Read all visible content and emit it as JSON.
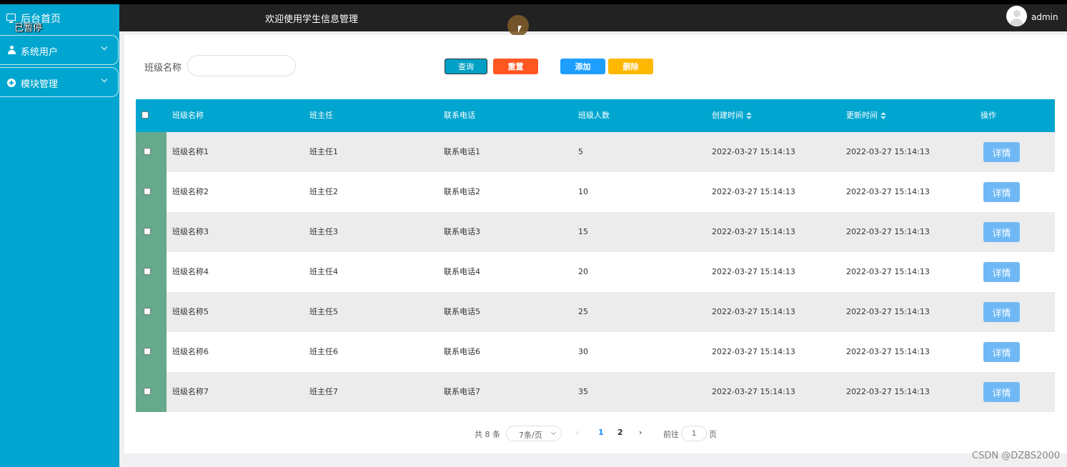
{
  "sidebar": {
    "home_label": "后台首页",
    "paused_label": "已暂停",
    "items": [
      {
        "label": "系统用户",
        "icon": "user-icon"
      },
      {
        "label": "模块管理",
        "icon": "plus-circle-icon"
      }
    ]
  },
  "header": {
    "title": "欢迎使用学生信息管理",
    "username": "admin"
  },
  "search": {
    "label": "班级名称",
    "value": "",
    "placeholder": ""
  },
  "toolbar": {
    "query_label": "查询",
    "reset_label": "重置",
    "add_label": "添加",
    "delete_label": "删除"
  },
  "table": {
    "columns": [
      "班级名称",
      "班主任",
      "联系电话",
      "班级人数",
      "创建时间",
      "更新时间",
      "操作"
    ],
    "detail_label": "详情",
    "rows": [
      [
        "班级名称1",
        "班主任1",
        "联系电话1",
        "5",
        "2022-03-27 15:14:13",
        "2022-03-27 15:14:13"
      ],
      [
        "班级名称2",
        "班主任2",
        "联系电话2",
        "10",
        "2022-03-27 15:14:13",
        "2022-03-27 15:14:13"
      ],
      [
        "班级名称3",
        "班主任3",
        "联系电话3",
        "15",
        "2022-03-27 15:14:13",
        "2022-03-27 15:14:13"
      ],
      [
        "班级名称4",
        "班主任4",
        "联系电话4",
        "20",
        "2022-03-27 15:14:13",
        "2022-03-27 15:14:13"
      ],
      [
        "班级名称5",
        "班主任5",
        "联系电话5",
        "25",
        "2022-03-27 15:14:13",
        "2022-03-27 15:14:13"
      ],
      [
        "班级名称6",
        "班主任6",
        "联系电话6",
        "30",
        "2022-03-27 15:14:13",
        "2022-03-27 15:14:13"
      ],
      [
        "班级名称7",
        "班主任7",
        "联系电话7",
        "35",
        "2022-03-27 15:14:13",
        "2022-03-27 15:14:13"
      ]
    ]
  },
  "pagination": {
    "total_text": "共 8 条",
    "page_size": "7条/页",
    "prev": "‹",
    "pages": [
      "1",
      "2"
    ],
    "next": "›",
    "goto_label": "前往",
    "goto_value": "1",
    "page_suffix": "页"
  },
  "watermark": "CSDN @DZBS2000",
  "colors": {
    "sidebar": "#00a6cf",
    "header": "#222222",
    "table_header": "#00a6cf",
    "checkbox_column": "#66a98c",
    "reset": "#ff5722",
    "add": "#1e9fff",
    "delete": "#ffb800",
    "detail": "#6fb8f5"
  }
}
